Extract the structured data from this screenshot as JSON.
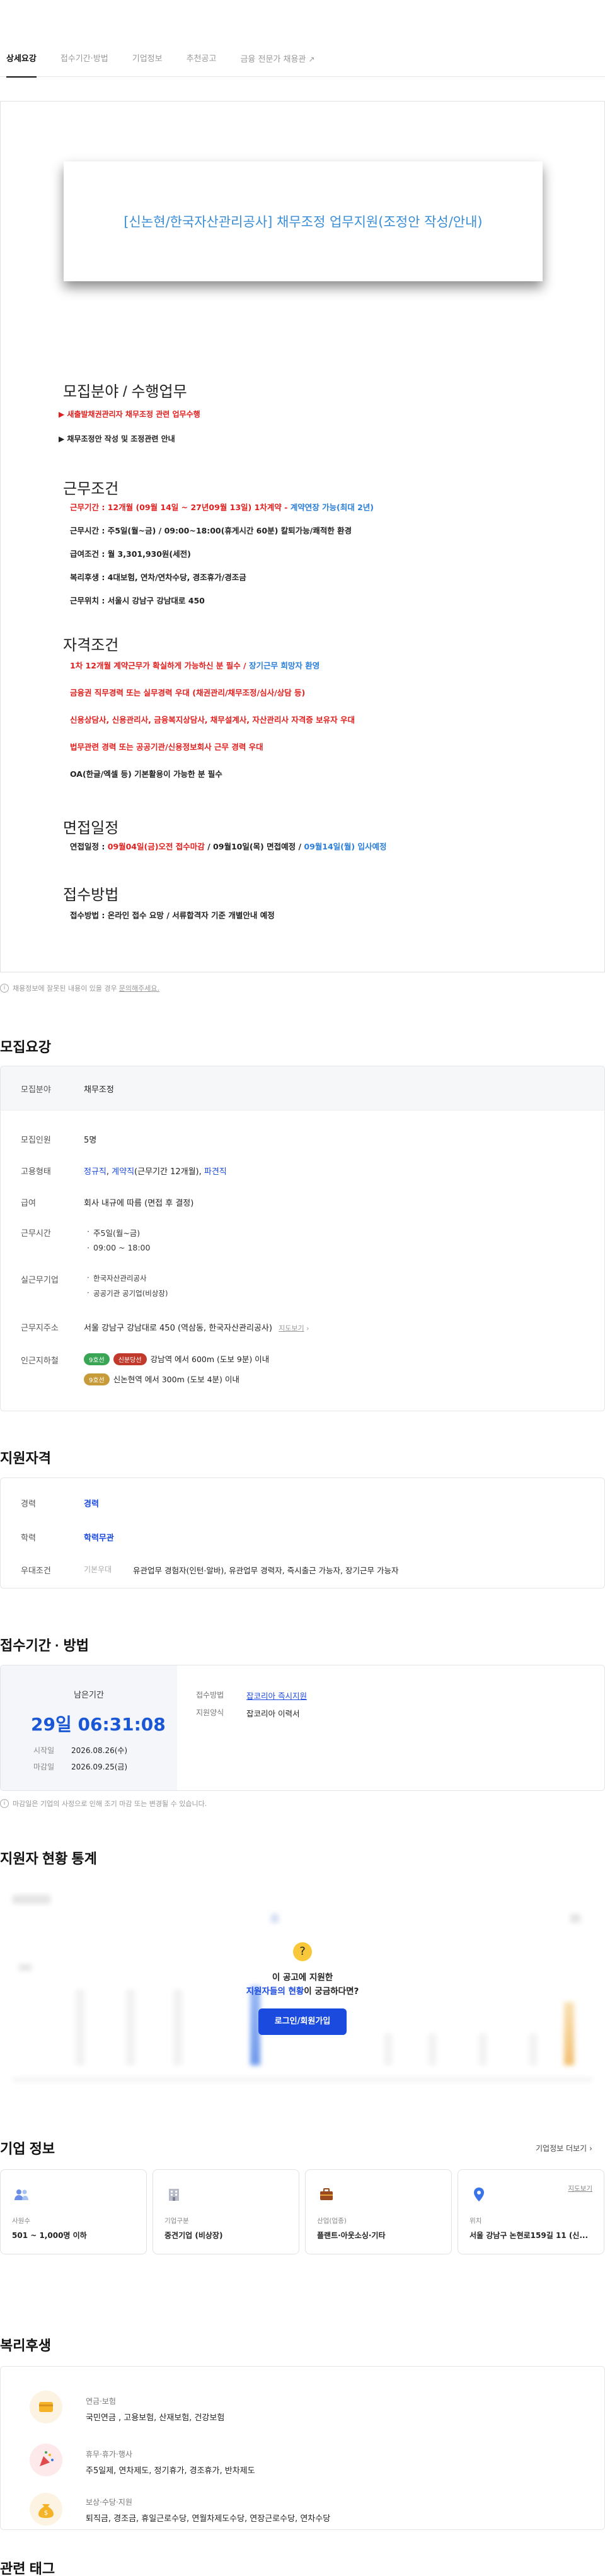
{
  "tabs": [
    {
      "label": "상세요강"
    },
    {
      "label": "접수기간·방법"
    },
    {
      "label": "기업정보"
    },
    {
      "label": "추천공고"
    },
    {
      "label": "금융 전문가 채용관"
    }
  ],
  "jd": {
    "banner_title": "[신논현/한국자산관리공사] 채무조정 업무지원(조정안 작성/안내)",
    "sections": {
      "s1_title": "모집분야 / 수행업무",
      "s1_l1": "▶ 새출발채권관리자 채무조정 관련 업무수행",
      "s1_l2": "▶ 채무조정안 작성 및 조정관련 안내",
      "s2_title": "근무조건",
      "s2_l1_a": "근무기간 : 12개월 (09월 14일 ~ 27년09월 13일) 1차계약 - ",
      "s2_l1_b": "계약연장 가능(최대 2년)",
      "s2_l2": "근무시간 : 주5일(월~금) / 09:00~18:00(휴게시간 60분) 칼퇴가능/쾌적한 환경",
      "s2_l3": "급여조건 : 월 3,301,930원(세전)",
      "s2_l4": "복리후생 : 4대보험, 연차/연차수당, 경조휴가/경조금",
      "s2_l5": "근무위치 : 서울시 강남구 강남대로 450",
      "s3_title": "자격조건",
      "s3_l1_a": "1차 12개월 계약근무가 확실하게 가능하신 분 필수 / ",
      "s3_l1_b": "장기근무 희망자 환영",
      "s3_l2": "금융권 직무경력 또는 실무경력 우대 (채권관리/채무조정/심사/상담 등)",
      "s3_l3": "신용상담사, 신용관리사, 금융복지상담사, 채무설계사, 자산관리사 자격증 보유자 우대",
      "s3_l4": "법무관련 경력 또는 공공기관/신용정보회사 근무 경력 우대",
      "s3_l5": "OA(한글/엑셀 등) 기본활용이 가능한 분 필수",
      "s4_title": "면접일정",
      "s4_l1_a": "연접일정 : ",
      "s4_l1_b": "09월04일(금)오전 접수마감",
      "s4_l1_c": " / 09월10일(목) 면접예정 / ",
      "s4_l1_d": "09월14일(월) 입사예정",
      "s5_title": "접수방법",
      "s5_l1": "접수방법 : 온라인 접수 요망 / 서류합격자 기준 개별안내 예정"
    }
  },
  "notice1": {
    "text": "채용정보에 잘못된 내용이 있을 경우",
    "link": "문의해주세요."
  },
  "recruit": {
    "title": "모집요강",
    "field_label": "모집분야",
    "field_value": "채무조정",
    "count_label": "모집인원",
    "count_value": "5명",
    "type_label": "고용형태",
    "type_a": "정규직",
    "type_b": "계약직",
    "type_c": "(근무기간 12개월), ",
    "type_d": "파견직",
    "pay_label": "급여",
    "pay_value": "회사 내규에 따름 (면접 후 결정)",
    "hours_label": "근무시간",
    "hours_1": "주5일(월~금)",
    "hours_2": "09:00 ~ 18:00",
    "actual_label": "실근무기업",
    "actual_1": "한국자산관리공사",
    "actual_2": "공공기관 공기업(비상장)",
    "addr_label": "근무지주소",
    "addr_value": "서울 강남구 강남대로 450 (역삼동, 한국자산관리공사)",
    "map_link": "지도보기",
    "near_label": "인근지하철",
    "near_1_badges": [
      "9호선",
      "신분당선"
    ],
    "near_1_text": "강남역 에서 600m (도보 9분) 이내",
    "near_2_badges": [
      "9호선"
    ],
    "near_2_text": "신논현역 에서 300m (도보 4분) 이내"
  },
  "qual": {
    "title": "지원자격",
    "career_label": "경력",
    "career_value": "경력",
    "edu_label": "학력",
    "edu_value": "학력무관",
    "pref_label": "우대조건",
    "pref_sub": "기본우대",
    "pref_value": "유관업무 경험자(인턴·알바), 유관업무 경력자, 즉시출근 가능자, 장기근무 가능자"
  },
  "period": {
    "title": "접수기간 · 방법",
    "remain_label": "남은기간",
    "countdown": "29일 06:31:08",
    "start_label": "시작일",
    "start_value": "2026.08.26(수)",
    "end_label": "마감일",
    "end_value": "2026.09.25(금)",
    "method_label": "접수방법",
    "method_value": "잡코리아 즉시지원",
    "form_label": "지원양식",
    "form_value": "잡코리아 이력서",
    "notice": "마감일은 기업의 사정으로 인해 조기 마감 또는 변경될 수 있습니다."
  },
  "stats": {
    "title": "지원자 현황 통계",
    "prompt_1": "이 공고에 지원한",
    "prompt_2a": "지원자들의 현황",
    "prompt_2b": "이 궁금하다면?",
    "login": "로그인/회원가입"
  },
  "company": {
    "title": "기업 정보",
    "more": "기업정보 더보기",
    "cards": [
      {
        "label": "사원수",
        "value": "501 ~ 1,000명 이하"
      },
      {
        "label": "기업구분",
        "value": "중견기업 (비상장)"
      },
      {
        "label": "산업(업종)",
        "value": "플랜트·아웃소싱·기타"
      },
      {
        "label": "위치",
        "value": "서울 강남구 논현로159길 11 (신..."
      }
    ],
    "map_link": "지도보기"
  },
  "welfare": {
    "title": "복리후생",
    "items": [
      {
        "title": "연금·보험",
        "value": "국민연금 , 고용보험, 산재보험, 건강보험"
      },
      {
        "title": "휴무·휴가·행사",
        "value": "주5일제, 연차제도, 정기휴가, 경조휴가, 반차제도"
      },
      {
        "title": "보상·수당·지원",
        "value": "퇴직금, 경조금, 휴일근로수당, 연월차제도수당, 연장근로수당, 연차수당"
      }
    ]
  },
  "tags": {
    "title": "관련 태그"
  },
  "colors": {
    "accent_blue": "#1a4bde",
    "red": "#e0201f",
    "link_blue": "#2b7fd8"
  }
}
